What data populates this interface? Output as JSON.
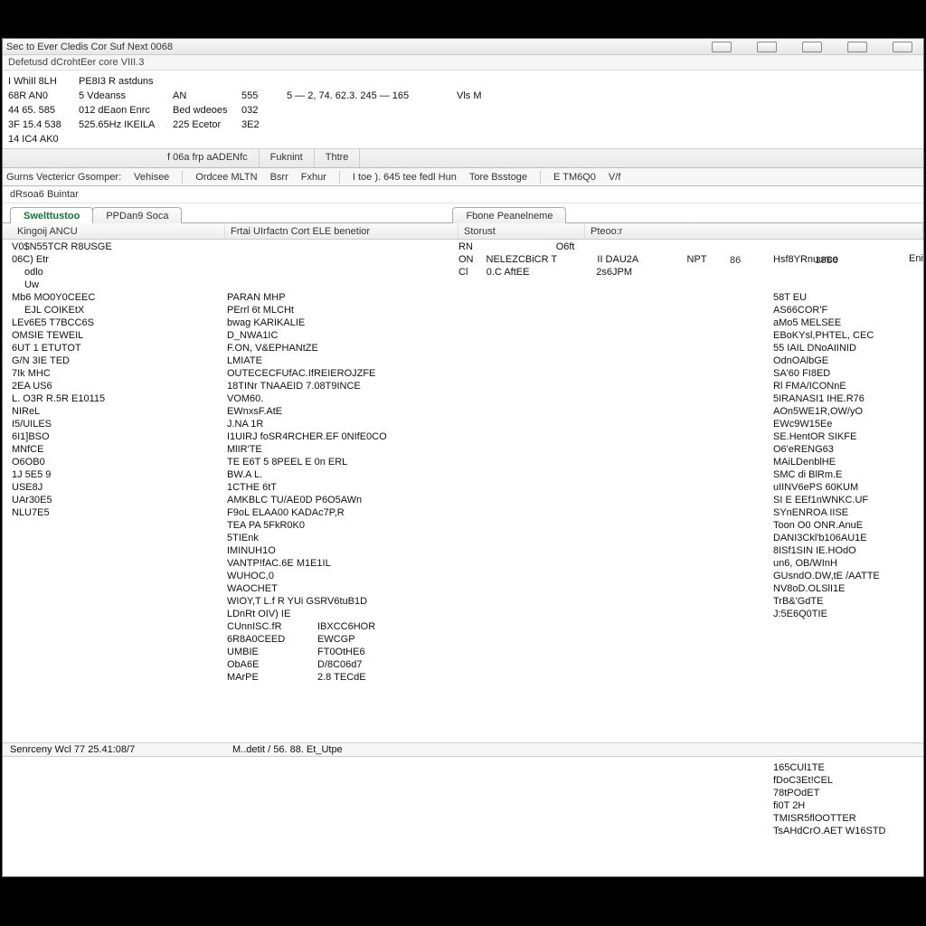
{
  "titlebar": {
    "title": "Sec to Ever  Cledis Cor Suf Next 0068"
  },
  "subtitle": "Defetusd dCrohtEer core VIII.3",
  "stats_rows": [
    {
      "a": "I WhiIl 8LH",
      "b": "PE8I3 R astduns",
      "c": "",
      "d": "",
      "e": "",
      "f": "",
      "g": ""
    },
    {
      "a": "68R AN0",
      "b": "5  Vdeanss",
      "c": "AN",
      "d": "555",
      "e": "5 — 2, 74. 62.3. 245 — 165",
      "f": "",
      "g": "Vls M"
    },
    {
      "a": "44 65. 585",
      "b": "012 dEaon Enrc",
      "c": "Bed  wdeoes",
      "d": "032",
      "e": "",
      "f": "",
      "g": ""
    },
    {
      "a": "3F 15.4 538",
      "b": "525.65Hz   IKEILA",
      "c": "225 Ecetor",
      "d": "3E2",
      "e": "",
      "f": "",
      "g": ""
    },
    {
      "a": "14 IC4  AK0",
      "b": "",
      "c": "",
      "d": "",
      "e": "",
      "f": "",
      "g": ""
    }
  ],
  "toolbar1": {
    "a": "f 06a frp aADENfc",
    "b": "Fuknint",
    "c": "Thtre"
  },
  "toolbar2": [
    "Gurns Vectericr Gsomper:",
    "Vehisee",
    "Ordcee MLTN",
    "Bsrr",
    "Fxhur",
    "I toe ). 645 tee fedl Hun",
    "Tore Bsstoge",
    "E    TM6Q0",
    "V/f"
  ],
  "section_label": "dRsoa6 Buintar",
  "tabs": {
    "a": "Swelttustoo",
    "b": "PPDan9 Soca",
    "c": "Fbone Peanelneme"
  },
  "colheads": {
    "h1": "Kingoij ANCU",
    "h2": "Frtai  UIrfactn  Cort ELE benetior",
    "h3": "Storust",
    "h4": "Pteoo:r"
  },
  "top_right_heads": {
    "a": "86",
    "b": "18B0"
  },
  "left_col": [
    "V0$N55TCR  R8USGE",
    "06C) Etr",
    "odlo",
    "Uw",
    "Mb6  MO0Y0CEEC",
    "EJL  COIKEtX",
    "LEv6E5   T7BCC6S",
    "OMSIE   TEWEIL",
    "6UT  1   ETUTOT",
    "G/N   3IE TED",
    "7Ik  MHC",
    "2EA  US6",
    "L. O3R  R.5R E10115",
    "NIReL",
    "I5/UILES",
    "6I1]BSO",
    "MNfCE",
    "O6OB0",
    "1J 5E5 9",
    "USE8J",
    "UAr30E5",
    "NLU7E5"
  ],
  "left_col_indents": [
    2,
    3,
    5
  ],
  "mid_col": [
    "",
    "",
    "",
    "",
    "PARAN MHP",
    "PErrl 6t  MLCHt",
    "bwag   KARIKALIE",
    "D_NWA1IC",
    "F.ON,    V&EPHANtZE",
    "LMIATE",
    "OUTECECFUfAC.IfREIEROJZFE",
    "18TINr    TNAAEID  7.08T9INCE",
    "VOM60.",
    "EWnxsF.AtE",
    "J.NA 1R",
    "I1UIRJ  foSR4RCHER.EF 0NIfE0CO",
    "MlIR'TE",
    "TE  E6T  5 8PEEL E 0n ERL",
    "BW.A  L.",
    "1CTHE     6tT",
    "AMKBLC    TU/AE0D P6O5AWn",
    "F9oL   ELAA00 KADAc7P,R",
    "TEA PA   5FkR0K0",
    "5TIEnk",
    "IMINUH1O",
    "VANTP!fAC.6E M1E1IL",
    "WUHOC,0",
    "WAOCHET",
    "WIOY,T   L.f R  YUi GSRV6tuB1D",
    "LDnRt OIV) IE"
  ],
  "mid_pairs": [
    {
      "a": "CUnnISC.fR",
      "b": "IBXCC6HOR"
    },
    {
      "a": "6R8A0CEED",
      "b": "EWCGP"
    },
    {
      "a": "UMBIE",
      "b": "FT0OtHE6"
    },
    {
      "a": "ObA6E",
      "b": "D/8C06d7"
    },
    {
      "a": "MArPE",
      "b": "2.8 TECdE"
    }
  ],
  "stat_rows": [
    {
      "a": "RN",
      "b": "",
      "c": "O6ft",
      "d": "",
      "e": "",
      "f": ""
    },
    {
      "a": "ON",
      "b": "NELEZCBiCR T",
      "c": "",
      "d": "II  DAU2A",
      "e": "",
      "f": "NPT"
    },
    {
      "a": "Cl",
      "b": "0.C AftEE",
      "c": "",
      "d": "2s6JPM",
      "e": "",
      "f": ""
    }
  ],
  "right_col": [
    "",
    "Hsf8YRnuurce",
    "",
    "",
    "58T EU",
    "AS66COR'F",
    "aMo5   MELSEE",
    "EBoKYsl,PHTEL, CEC",
    "55 IAIL  DNoAIINID",
    "OdnOAlbGE",
    "SA'60 FI8ED",
    "Rl  FMA/ICONnE",
    "5IRANASI1  IHE.R76",
    "AOn5WE1R,OW/yO",
    "EWc9W15Ee",
    "SE.HentOR SIKFE",
    "O6'eRENG63",
    "MAiLDenblHE",
    "SMC  di BlRm.E",
    "uIINV6ePS 60KUM",
    "SI E    EEf1nWNKC.UF",
    "SYnENROA IISE",
    "Toon   O0   ONR.AnuE",
    "DANI3Ckl'b106AU1E",
    "8ISf1SIN   IE.HOdO",
    "un6,  OB/WInH",
    "GUsndO.DW,tE   /AATTE",
    "NV8oD.OLSlI1E",
    "TrB&'GdTE",
    "J:5E6Q0TIE"
  ],
  "statusbar": {
    "left": "Senrceny Wcl 77  25.41:08/7",
    "mid": "M..detit / 56. 88.  Et_Utpe"
  },
  "bottom_list": [
    "165CUl1TE",
    "fDoC3Et!CEL",
    "78tPOdET",
    "fi0T  2H",
    "TMISR5flOOTTER",
    "TsAHdCrO.AET W16STD"
  ],
  "right_head_extra": "Enitio C"
}
